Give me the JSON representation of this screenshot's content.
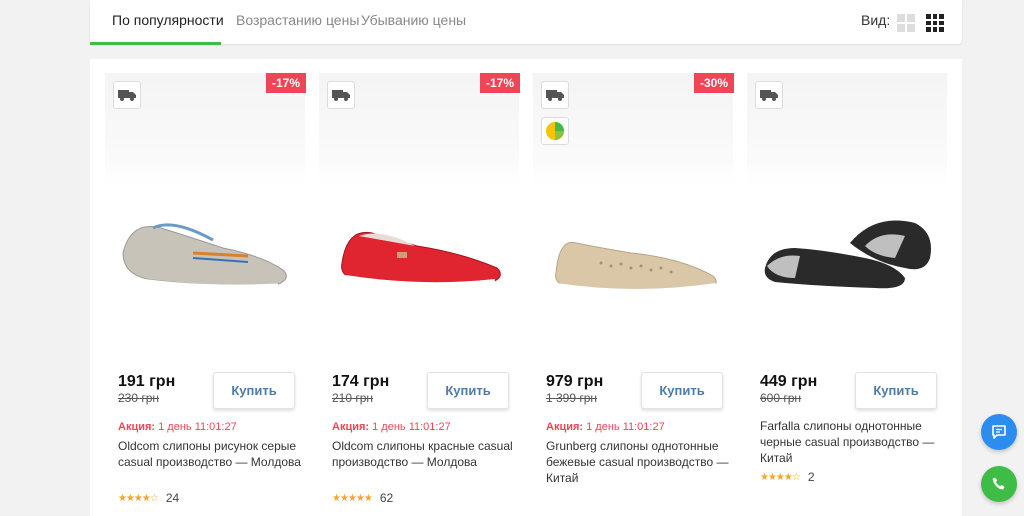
{
  "sort": {
    "tabs": [
      "По популярности",
      "Возрастанию цены",
      "Убыванию цены"
    ],
    "view_label": "Вид:"
  },
  "buy_label": "Купить",
  "products": [
    {
      "discount": "-17%",
      "price": "191 грн",
      "old_price": "230 грн",
      "promo_label": "Акция:",
      "promo_time": "1 день 11:01:27",
      "title": "Oldcom слипоны рисунок серые casual производство — Молдова",
      "stars": "★★★★☆",
      "reviews": "24",
      "shoe_color": "#c8c3b8"
    },
    {
      "discount": "-17%",
      "price": "174 грн",
      "old_price": "210 грн",
      "promo_label": "Акция:",
      "promo_time": "1 день 11:01:27",
      "title": "Oldcom слипоны красные casual производство — Молдова",
      "stars": "★★★★★",
      "reviews": "62",
      "shoe_color": "#e02430"
    },
    {
      "discount": "-30%",
      "price": "979 грн",
      "old_price": "1 399 грн",
      "promo_label": "Акция:",
      "promo_time": "1 день 11:01:27",
      "title": "Grunberg слипоны однотонные бежевые casual производство — Китай",
      "stars": "",
      "reviews": "",
      "shoe_color": "#d9c7a8"
    },
    {
      "discount": "",
      "price": "449 грн",
      "old_price": "600 грн",
      "promo_label": "",
      "promo_time": "",
      "title": "Farfalla слипоны однотонные черные casual производство — Китай",
      "stars": "★★★★☆",
      "reviews": "2",
      "shoe_color": "#2a2a2a"
    }
  ],
  "colors": {
    "accent": "#3dbd45",
    "discount": "#f04556",
    "buy_text": "#4f7ba8",
    "chat": "#2d8cf0",
    "phone": "#3dbd45"
  },
  "icons": [
    "delivery-truck-icon",
    "pie-chart-icon",
    "chat-icon",
    "phone-icon"
  ]
}
